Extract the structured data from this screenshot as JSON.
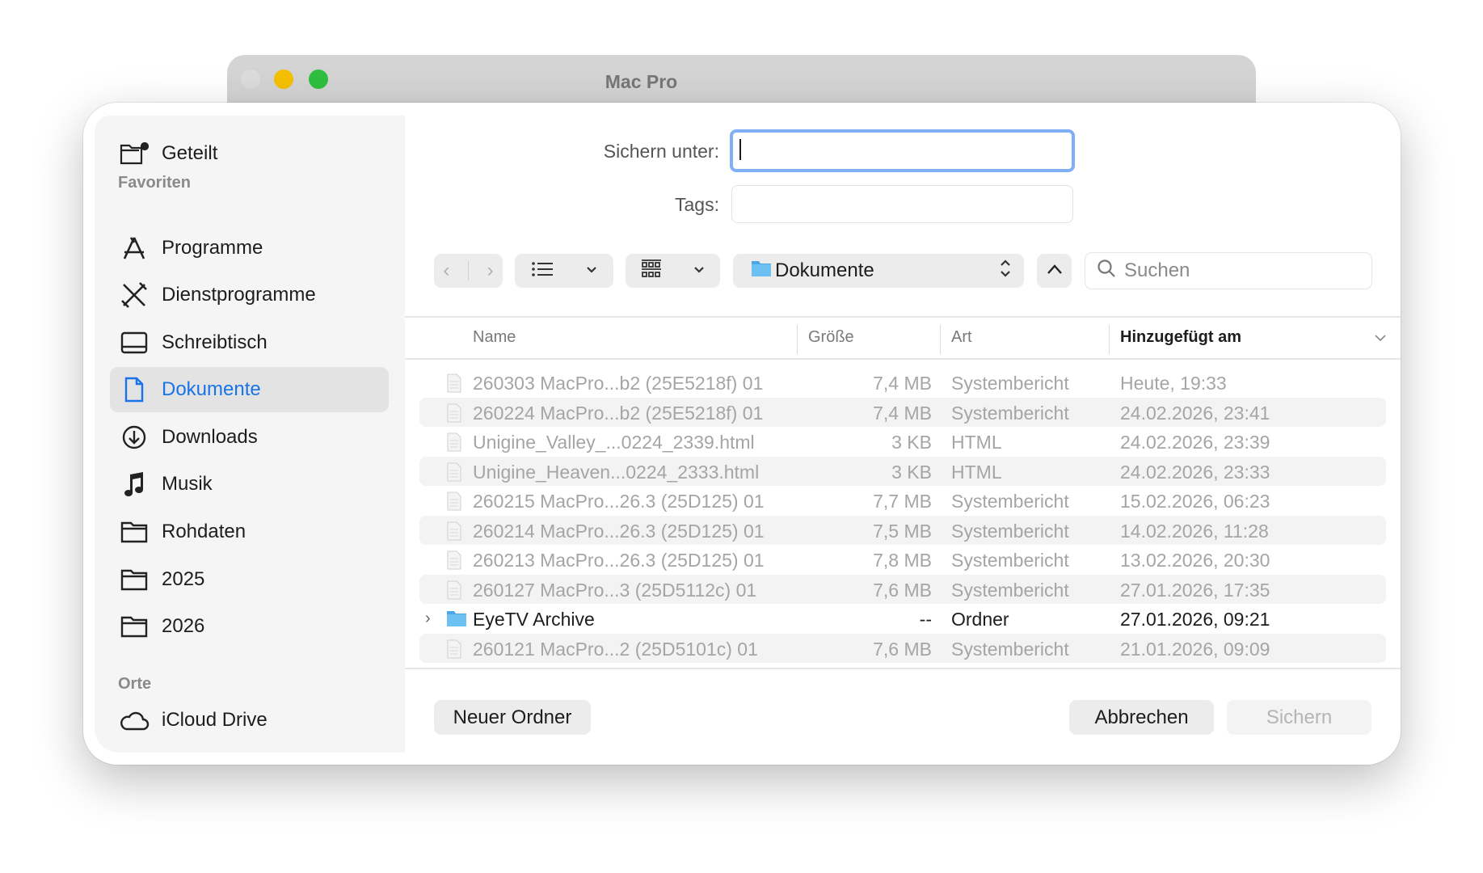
{
  "window": {
    "title": "Mac Pro",
    "traffic": {
      "close": "#dcdcdc",
      "minimize": "#f5c000",
      "zoom": "#2fbf3f"
    }
  },
  "sidebar": {
    "top": {
      "label": "Geteilt",
      "icon": "shared-folder-icon"
    },
    "favorites_header": "Favoriten",
    "favorites": [
      {
        "label": "Programme",
        "icon": "apps-icon"
      },
      {
        "label": "Dienstprogramme",
        "icon": "tools-icon"
      },
      {
        "label": "Schreibtisch",
        "icon": "desktop-icon"
      },
      {
        "label": "Dokumente",
        "icon": "document-icon",
        "selected": true
      },
      {
        "label": "Downloads",
        "icon": "download-icon"
      },
      {
        "label": "Musik",
        "icon": "music-icon"
      },
      {
        "label": "Rohdaten",
        "icon": "folder-icon"
      },
      {
        "label": "2025",
        "icon": "folder-icon"
      },
      {
        "label": "2026",
        "icon": "folder-icon"
      }
    ],
    "places_header": "Orte",
    "places": [
      {
        "label": "iCloud Drive",
        "icon": "cloud-icon"
      }
    ]
  },
  "form": {
    "save_as_label": "Sichern unter:",
    "save_as_value": "",
    "tags_label": "Tags:",
    "tags_value": ""
  },
  "toolbar": {
    "location": "Dokumente",
    "search_placeholder": "Suchen"
  },
  "columns": {
    "name": "Name",
    "size": "Größe",
    "kind": "Art",
    "added": "Hinzugefügt am"
  },
  "files": [
    {
      "name": "260303 MacPro...b2 (25E5218f) 01",
      "size": "7,4 MB",
      "kind": "Systembericht",
      "added": "Heute, 19:33"
    },
    {
      "name": "260224 MacPro...b2 (25E5218f) 01",
      "size": "7,4 MB",
      "kind": "Systembericht",
      "added": "24.02.2026, 23:41"
    },
    {
      "name": "Unigine_Valley_...0224_2339.html",
      "size": "3 KB",
      "kind": "HTML",
      "added": "24.02.2026, 23:39"
    },
    {
      "name": "Unigine_Heaven...0224_2333.html",
      "size": "3 KB",
      "kind": "HTML",
      "added": "24.02.2026, 23:33"
    },
    {
      "name": "260215 MacPro...26.3 (25D125) 01",
      "size": "7,7 MB",
      "kind": "Systembericht",
      "added": "15.02.2026, 06:23"
    },
    {
      "name": "260214 MacPro...26.3 (25D125) 01",
      "size": "7,5 MB",
      "kind": "Systembericht",
      "added": "14.02.2026, 11:28"
    },
    {
      "name": "260213 MacPro...26.3 (25D125) 01",
      "size": "7,8 MB",
      "kind": "Systembericht",
      "added": "13.02.2026, 20:30"
    },
    {
      "name": "260127 MacPro...3 (25D5112c) 01",
      "size": "7,6 MB",
      "kind": "Systembericht",
      "added": "27.01.2026, 17:35"
    },
    {
      "name": "EyeTV Archive",
      "size": "--",
      "kind": "Ordner",
      "added": "27.01.2026, 09:21",
      "folder": true
    },
    {
      "name": "260121 MacPro...2 (25D5101c) 01",
      "size": "7,6 MB",
      "kind": "Systembericht",
      "added": "21.01.2026, 09:09"
    }
  ],
  "buttons": {
    "new_folder": "Neuer Ordner",
    "cancel": "Abbrechen",
    "save": "Sichern"
  }
}
